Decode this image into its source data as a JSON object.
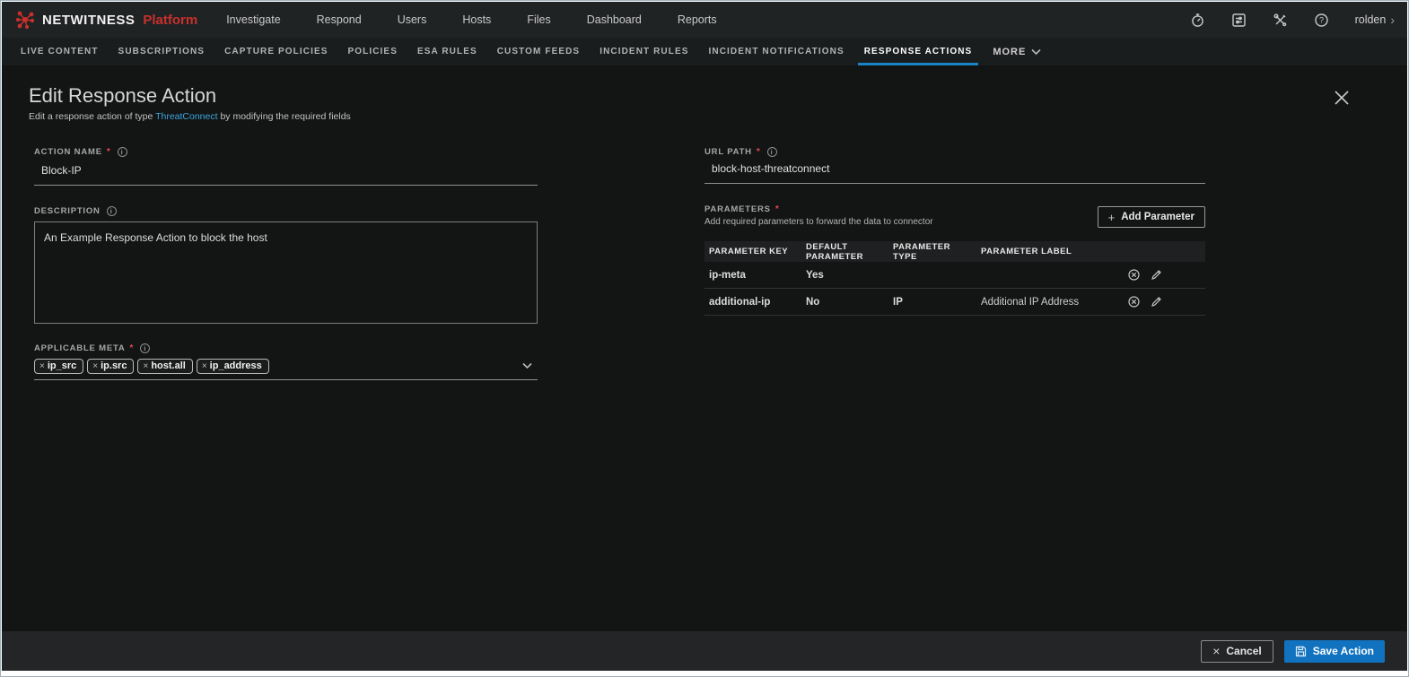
{
  "header": {
    "brand": {
      "name": "NETWITNESS",
      "suffix": "Platform"
    },
    "nav_items": [
      "Investigate",
      "Respond",
      "Users",
      "Hosts",
      "Files",
      "Dashboard",
      "Reports"
    ],
    "icons": [
      "timer-icon",
      "jobs-icon",
      "admin-tools-icon",
      "help-icon"
    ],
    "user": "rolden",
    "user_chevron": "›"
  },
  "tabs": {
    "items": [
      {
        "label": "LIVE CONTENT",
        "active": false
      },
      {
        "label": "SUBSCRIPTIONS",
        "active": false
      },
      {
        "label": "CAPTURE POLICIES",
        "active": false
      },
      {
        "label": "POLICIES",
        "active": false
      },
      {
        "label": "ESA RULES",
        "active": false
      },
      {
        "label": "CUSTOM FEEDS",
        "active": false
      },
      {
        "label": "INCIDENT RULES",
        "active": false
      },
      {
        "label": "INCIDENT NOTIFICATIONS",
        "active": false
      },
      {
        "label": "RESPONSE ACTIONS",
        "active": true
      }
    ],
    "more_label": "MORE"
  },
  "panel": {
    "title": "Edit Response Action",
    "subtitle_prefix": "Edit a response action of type ",
    "subtitle_link": "ThreatConnect",
    "subtitle_suffix": " by modifying the required fields"
  },
  "form": {
    "required_marker": "*",
    "info_glyph": "i",
    "action_name": {
      "label": "ACTION NAME",
      "value": "Block-IP",
      "required": true
    },
    "description": {
      "label": "DESCRIPTION",
      "value": "An Example Response Action to block the host"
    },
    "applicable_meta": {
      "label": "APPLICABLE META",
      "required": true,
      "remove_glyph": "×",
      "tags": [
        "ip_src",
        "ip.src",
        "host.all",
        "ip_address"
      ]
    },
    "url_path": {
      "label": "URL PATH",
      "value": "block-host-threatconnect",
      "required": true
    },
    "parameters": {
      "label": "PARAMETERS",
      "required": true,
      "hint": "Add required parameters to forward the data to connector",
      "add_button": {
        "plus_glyph": "+",
        "label": "Add Parameter"
      },
      "table": {
        "headers": [
          "PARAMETER KEY",
          "DEFAULT PARAMETER",
          "PARAMETER TYPE",
          "PARAMETER LABEL"
        ],
        "rows": [
          {
            "key": "ip-meta",
            "default": "Yes",
            "type": "",
            "label": ""
          },
          {
            "key": "additional-ip",
            "default": "No",
            "type": "IP",
            "label": "Additional IP Address..."
          }
        ],
        "row_icons": [
          "delete-icon",
          "edit-icon"
        ]
      }
    }
  },
  "footer": {
    "cancel": {
      "glyph": "×",
      "label": "Cancel"
    },
    "save": {
      "label": "Save Action"
    }
  },
  "colors": {
    "accent_blue": "#1b84c7",
    "link_blue": "#3ba6dc",
    "save_button_blue": "#1173c0",
    "required_red": "#e04b4b",
    "brand_red": "#c9302c",
    "background_dark": "#131414"
  }
}
